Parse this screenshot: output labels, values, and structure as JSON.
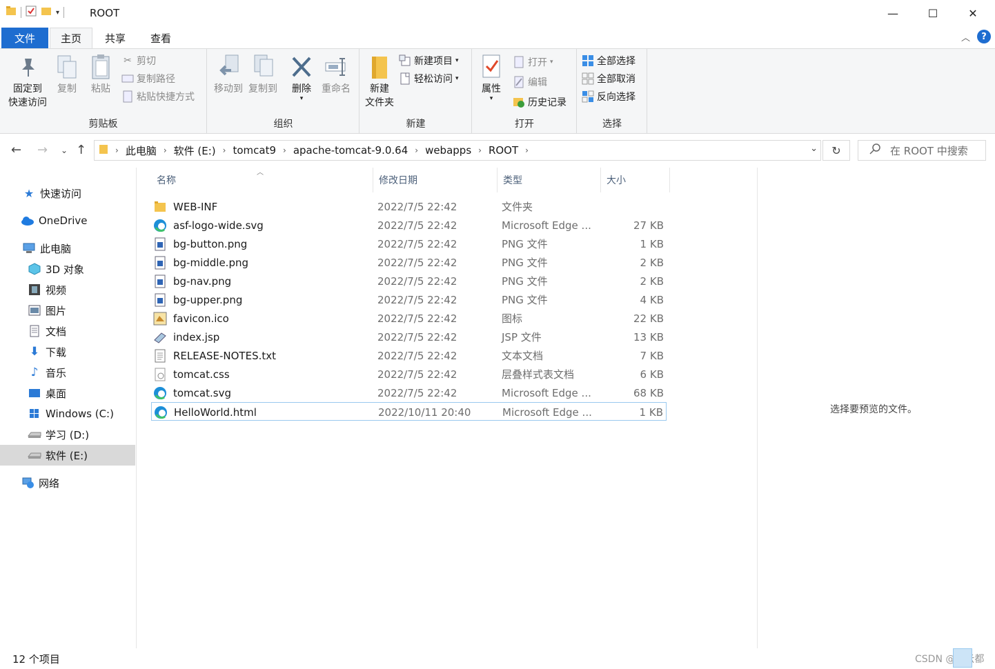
{
  "window": {
    "title": "ROOT",
    "minimize": "—",
    "maximize": "☐",
    "close": "✕"
  },
  "tabs": [
    {
      "label": "文件"
    },
    {
      "label": "主页"
    },
    {
      "label": "共享"
    },
    {
      "label": "查看"
    }
  ],
  "ribbon": {
    "clipboard": {
      "group_label": "剪贴板",
      "pin_line1": "固定到",
      "pin_line2": "快速访问",
      "copy": "复制",
      "paste": "粘贴",
      "cut": "剪切",
      "copy_path": "复制路径",
      "paste_shortcut": "粘贴快捷方式"
    },
    "organize": {
      "group_label": "组织",
      "move_to": "移动到",
      "copy_to": "复制到",
      "delete": "删除",
      "rename": "重命名"
    },
    "new": {
      "group_label": "新建",
      "new_folder_line1": "新建",
      "new_folder_line2": "文件夹",
      "new_item": "新建项目",
      "easy_access": "轻松访问"
    },
    "open": {
      "group_label": "打开",
      "properties": "属性",
      "open": "打开",
      "edit": "编辑",
      "history": "历史记录"
    },
    "select": {
      "group_label": "选择",
      "select_all": "全部选择",
      "select_none": "全部取消",
      "invert": "反向选择"
    }
  },
  "address": {
    "crumbs": [
      "此电脑",
      "软件 (E:)",
      "tomcat9",
      "apache-tomcat-9.0.64",
      "webapps",
      "ROOT"
    ],
    "search_placeholder": "在 ROOT 中搜索"
  },
  "nav": {
    "quick_access": "快速访问",
    "onedrive": "OneDrive",
    "this_pc": "此电脑",
    "objects3d": "3D 对象",
    "videos": "视频",
    "pictures": "图片",
    "documents": "文档",
    "downloads": "下载",
    "music": "音乐",
    "desktop": "桌面",
    "drive_c": "Windows (C:)",
    "drive_d": "学习 (D:)",
    "drive_e": "软件 (E:)",
    "network": "网络"
  },
  "columns": {
    "name": "名称",
    "date": "修改日期",
    "type": "类型",
    "size": "大小"
  },
  "files": [
    {
      "name": "WEB-INF",
      "date": "2022/7/5 22:42",
      "type": "文件夹",
      "size": "",
      "icon": "folder-icon"
    },
    {
      "name": "asf-logo-wide.svg",
      "date": "2022/7/5 22:42",
      "type": "Microsoft Edge ...",
      "size": "27 KB",
      "icon": "edge-icon"
    },
    {
      "name": "bg-button.png",
      "date": "2022/7/5 22:42",
      "type": "PNG 文件",
      "size": "1 KB",
      "icon": "image-file-icon"
    },
    {
      "name": "bg-middle.png",
      "date": "2022/7/5 22:42",
      "type": "PNG 文件",
      "size": "2 KB",
      "icon": "image-file-icon"
    },
    {
      "name": "bg-nav.png",
      "date": "2022/7/5 22:42",
      "type": "PNG 文件",
      "size": "2 KB",
      "icon": "image-file-icon"
    },
    {
      "name": "bg-upper.png",
      "date": "2022/7/5 22:42",
      "type": "PNG 文件",
      "size": "4 KB",
      "icon": "image-file-icon"
    },
    {
      "name": "favicon.ico",
      "date": "2022/7/5 22:42",
      "type": "图标",
      "size": "22 KB",
      "icon": "ico-file-icon"
    },
    {
      "name": "index.jsp",
      "date": "2022/7/5 22:42",
      "type": "JSP 文件",
      "size": "13 KB",
      "icon": "jsp-file-icon"
    },
    {
      "name": "RELEASE-NOTES.txt",
      "date": "2022/7/5 22:42",
      "type": "文本文档",
      "size": "7 KB",
      "icon": "text-file-icon"
    },
    {
      "name": "tomcat.css",
      "date": "2022/7/5 22:42",
      "type": "层叠样式表文档",
      "size": "6 KB",
      "icon": "css-file-icon"
    },
    {
      "name": "tomcat.svg",
      "date": "2022/7/5 22:42",
      "type": "Microsoft Edge ...",
      "size": "68 KB",
      "icon": "edge-icon"
    },
    {
      "name": "HelloWorld.html",
      "date": "2022/10/11 20:40",
      "type": "Microsoft Edge ...",
      "size": "1 KB",
      "icon": "edge-icon"
    }
  ],
  "preview_text": "选择要预览的文件。",
  "status": "12 个项目",
  "watermark": "CSDN @海云都",
  "colors": {
    "accent": "#1e6dd0",
    "selection_border": "#99c9ef",
    "nav_selected": "#d9d9d9",
    "folder": "#f4c44e"
  }
}
